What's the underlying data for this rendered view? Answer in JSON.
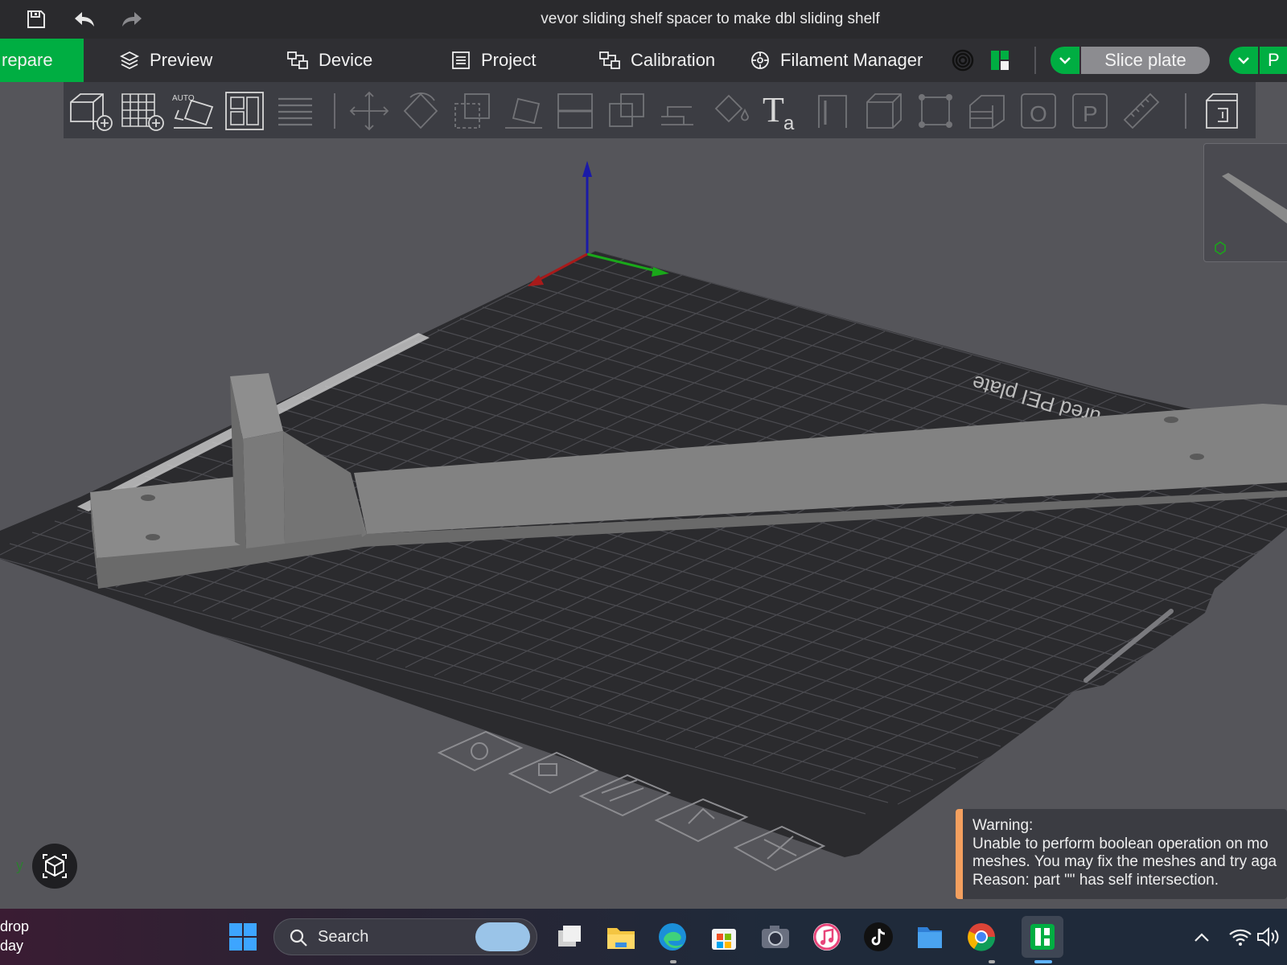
{
  "window": {
    "title": "vevor sliding shelf spacer to make dbl sliding shelf"
  },
  "tabs": [
    {
      "label": "repare",
      "active": true
    },
    {
      "label": "Preview",
      "active": false
    },
    {
      "label": "Device",
      "active": false
    },
    {
      "label": "Project",
      "active": false
    },
    {
      "label": "Calibration",
      "active": false
    },
    {
      "label": "Filament Manager",
      "active": false
    }
  ],
  "actions": {
    "slice_label": "Slice plate",
    "print_label": "P"
  },
  "toolbar": {
    "auto_text": "AUTO",
    "icons": [
      "add-object-icon",
      "add-plate-icon",
      "auto-orient-icon",
      "arrange-icon",
      "layers-icon",
      "move-icon",
      "rotate-icon",
      "scale-icon",
      "lay-on-face-icon",
      "cut-icon",
      "boolean-icon",
      "support-paint-icon",
      "color-paint-icon",
      "text-icon",
      "seam-icon",
      "mesh-boolean-icon",
      "measure-icon",
      "variable-layer-icon",
      "split-objects-icon",
      "split-parts-icon",
      "ruler-icon",
      "assembly-icon"
    ]
  },
  "viewport": {
    "plate_label": "ured PEI plate",
    "axis_y_label": "y"
  },
  "warning": {
    "title": "Warning:",
    "line1": "Unable to perform boolean operation on mo",
    "line2": "meshes. You may fix the meshes and try aga",
    "line3": "Reason: part \"\" has self intersection."
  },
  "taskbar": {
    "search_label": "Search",
    "widget_line1": "drop",
    "widget_line2": "day",
    "apps": [
      "start-icon",
      "task-view-icon",
      "file-explorer-icon",
      "edge-icon",
      "store-icon",
      "camera-icon",
      "itunes-icon",
      "tiktok-icon",
      "files-icon",
      "chrome-icon",
      "bambu-studio-icon"
    ]
  },
  "colors": {
    "accent": "#00ae42",
    "warning": "#f4a05f",
    "plate": "#2b2b2e",
    "part": "#808080"
  }
}
